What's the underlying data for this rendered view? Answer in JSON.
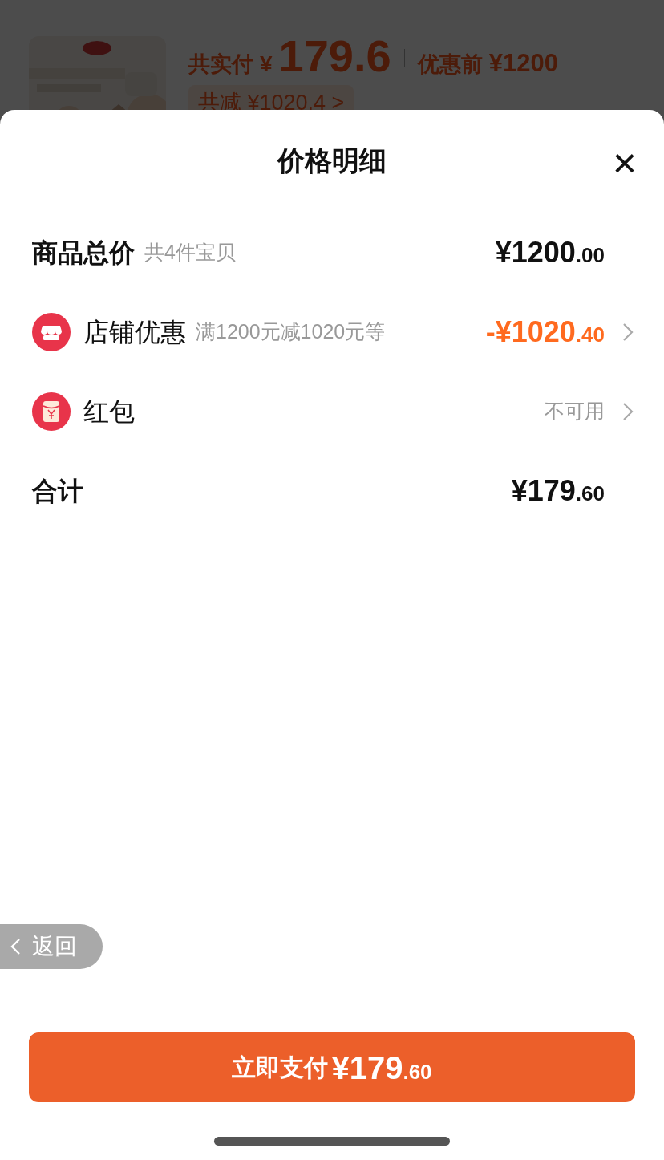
{
  "background_page": {
    "paid_label": "共实付",
    "paid_currency": "¥",
    "paid_amount": "179.6",
    "before_label": "优惠前",
    "before_amount": "¥1200",
    "saved_text": "共减 ¥1020.4 >"
  },
  "sheet": {
    "title": "价格明细",
    "close": "×",
    "rows": [
      {
        "kind": "subtotal",
        "label": "商品总价",
        "note": "共4件宝贝",
        "value": "¥1200.00",
        "chevron": false
      },
      {
        "kind": "discount",
        "label": "店铺优惠",
        "note": "满1200元减1020元等",
        "value": "-¥1020.40",
        "chevron": true
      },
      {
        "kind": "coupon",
        "label": "红包",
        "value": "不可用",
        "chevron": true
      },
      {
        "kind": "total",
        "label": "合计",
        "value": "¥179.60",
        "chevron": false
      }
    ],
    "back_button": {
      "label": "返回"
    },
    "pay_button": {
      "label": "立即支付",
      "amount": "¥179.60"
    }
  }
}
